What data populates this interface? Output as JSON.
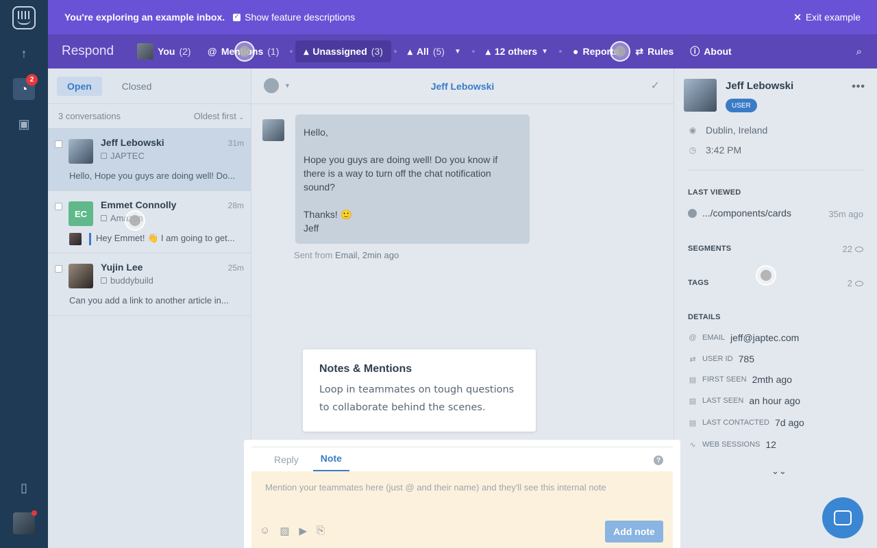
{
  "banner": {
    "message": "You're exploring an example inbox.",
    "checkbox_label": "Show feature descriptions",
    "exit_label": "Exit example"
  },
  "rail": {
    "inbox_badge": "2"
  },
  "nav": {
    "brand": "Respond",
    "items": [
      {
        "label": "You",
        "count": "(2)"
      },
      {
        "label": "Mentions",
        "count": "(1)"
      },
      {
        "label": "Unassigned",
        "count": "(3)"
      },
      {
        "label": "All",
        "count": "(5)"
      },
      {
        "label": "12 others",
        "count": ""
      },
      {
        "label": "Reports",
        "count": ""
      },
      {
        "label": "Rules",
        "count": ""
      },
      {
        "label": "About",
        "count": ""
      }
    ]
  },
  "list": {
    "tabs": [
      "Open",
      "Closed"
    ],
    "count_label": "3 conversations",
    "sort_label": "Oldest first",
    "conversations": [
      {
        "name": "Jeff Lebowski",
        "time": "31m",
        "company": "JAPTEC",
        "preview": "Hello, Hope you guys are doing well! Do..."
      },
      {
        "name": "Emmet Connolly",
        "initials": "EC",
        "time": "28m",
        "company": "Amazon",
        "preview": "Hey Emmet! 👋 I am going to get..."
      },
      {
        "name": "Yujin Lee",
        "time": "25m",
        "company": "buddybuild",
        "preview": "Can you add a link to another article in..."
      }
    ]
  },
  "conversation": {
    "title": "Jeff Lebowski",
    "message": {
      "greeting": "Hello,",
      "body": "Hope you guys are doing well! Do you know if there is a way to turn off the chat notification sound?",
      "thanks": "Thanks! 🙂",
      "signature": "Jeff"
    },
    "sent_prefix": "Sent from",
    "sent_via": "Email, 2min ago"
  },
  "tooltip": {
    "title": "Notes & Mentions",
    "body": "Loop in teammates on tough questions to collaborate behind the scenes."
  },
  "composer": {
    "tabs": [
      "Reply",
      "Note"
    ],
    "placeholder": "Mention your teammates here (just @ and their name) and they'll see this internal note",
    "help": "?",
    "add_label": "Add note"
  },
  "profile": {
    "name": "Jeff Lebowski",
    "role": "USER",
    "location": "Dublin, Ireland",
    "local_time": "3:42 PM",
    "last_viewed_title": "LAST VIEWED",
    "last_viewed_page": ".../components/cards",
    "last_viewed_time": "35m ago",
    "segments_title": "SEGMENTS",
    "segments_count": "22",
    "tags_title": "TAGS",
    "tags_count": "2",
    "details_title": "DETAILS",
    "details": [
      {
        "label": "EMAIL",
        "value": "jeff@japtec.com"
      },
      {
        "label": "USER ID",
        "value": "785"
      },
      {
        "label": "FIRST SEEN",
        "value": "2mth ago"
      },
      {
        "label": "LAST SEEN",
        "value": "an hour ago"
      },
      {
        "label": "LAST CONTACTED",
        "value": "7d ago"
      },
      {
        "label": "WEB SESSIONS",
        "value": "12"
      }
    ]
  }
}
